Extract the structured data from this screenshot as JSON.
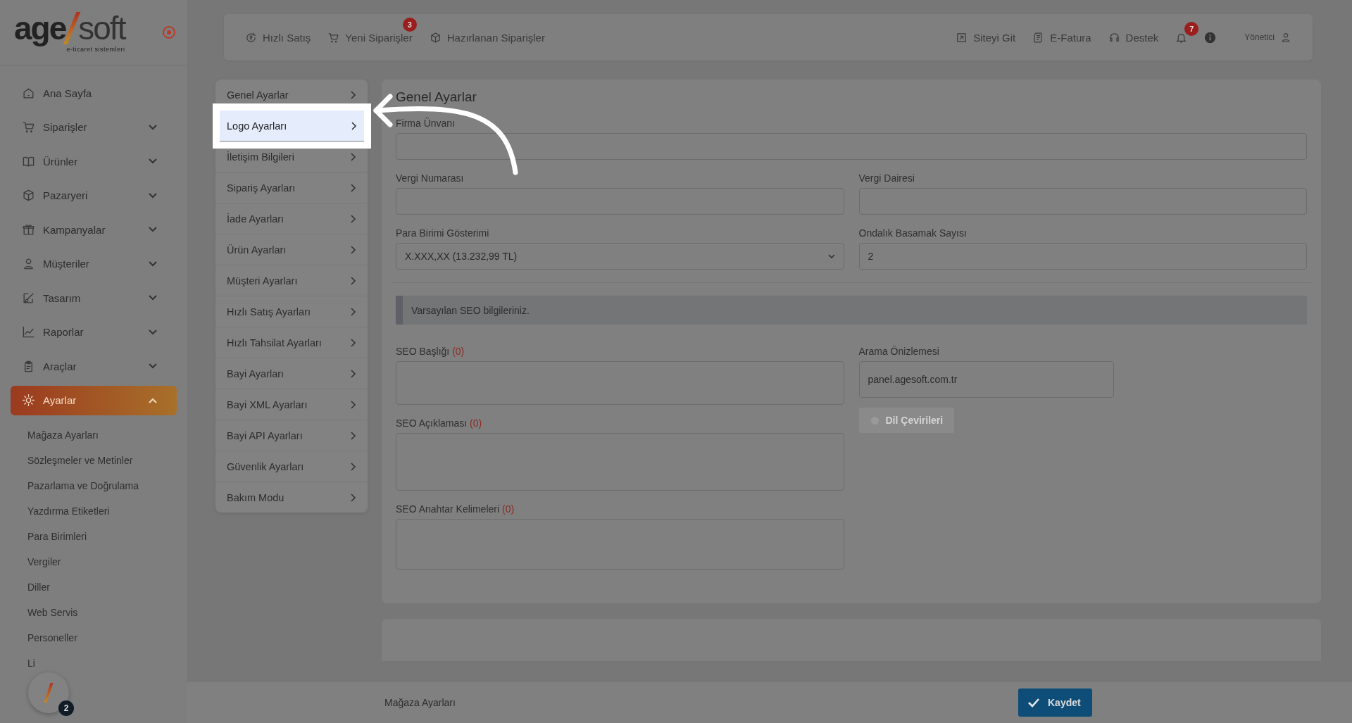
{
  "logo": {
    "left": "age",
    "right": "soft",
    "tagline": "e-ticaret sistemleri"
  },
  "sidebar": {
    "items": [
      {
        "label": "Ana Sayfa",
        "kind": "home",
        "selected": false
      },
      {
        "label": "Siparişler",
        "kind": "cart",
        "expanded": false,
        "selected": false
      },
      {
        "label": "Ürünler",
        "kind": "book",
        "expanded": false,
        "selected": false
      },
      {
        "label": "Pazaryeri",
        "kind": "box",
        "expanded": false,
        "selected": false
      },
      {
        "label": "Kampanyalar",
        "kind": "gift",
        "expanded": false,
        "selected": false
      },
      {
        "label": "Müşteriler",
        "kind": "user",
        "expanded": false,
        "selected": false
      },
      {
        "label": "Tasarım",
        "kind": "brush",
        "expanded": false,
        "selected": false
      },
      {
        "label": "Raporlar",
        "kind": "chart",
        "expanded": false,
        "selected": false
      },
      {
        "label": "Araçlar",
        "kind": "clipboard",
        "expanded": false,
        "selected": false
      },
      {
        "label": "Ayarlar",
        "kind": "gear",
        "expanded": true,
        "selected": true,
        "children": [
          {
            "label": "Mağaza Ayarları"
          },
          {
            "label": "Sözleşmeler ve Metinler"
          },
          {
            "label": "Pazarlama ve Doğrulama"
          },
          {
            "label": "Yazdırma Etiketleri"
          },
          {
            "label": "Para Birimleri"
          },
          {
            "label": "Vergiler"
          },
          {
            "label": "Diller"
          },
          {
            "label": "Web Servis"
          },
          {
            "label": "Personeller"
          },
          {
            "label": "Li"
          }
        ]
      }
    ]
  },
  "topbar": {
    "left": [
      {
        "label": "Hızlı Satış",
        "kind": "coin"
      },
      {
        "label": "Yeni Siparişler",
        "kind": "cart",
        "badge": "3"
      },
      {
        "label": "Hazırlanan Siparişler",
        "kind": "box"
      }
    ],
    "right": [
      {
        "label": "Siteyi Git",
        "kind": "external"
      },
      {
        "label": "E-Fatura",
        "kind": "invoice"
      },
      {
        "label": "Destek",
        "kind": "headset"
      }
    ],
    "notifications_badge": "7",
    "user": "Yönetici"
  },
  "settings_menu": [
    {
      "label": "Genel Ayarlar",
      "highlighted": false
    },
    {
      "label": "Logo Ayarları",
      "highlighted": true
    },
    {
      "label": "İletişim Bilgileri",
      "highlighted": false
    },
    {
      "label": "Sipariş Ayarları",
      "highlighted": false
    },
    {
      "label": "İade Ayarları",
      "highlighted": false
    },
    {
      "label": "Ürün Ayarları",
      "highlighted": false
    },
    {
      "label": "Müşteri Ayarları",
      "highlighted": false
    },
    {
      "label": "Hızlı Satış Ayarları",
      "highlighted": false
    },
    {
      "label": "Hızlı Tahsilat Ayarları",
      "highlighted": false
    },
    {
      "label": "Bayi Ayarları",
      "highlighted": false
    },
    {
      "label": "Bayi XML Ayarları",
      "highlighted": false
    },
    {
      "label": "Bayi API Ayarları",
      "highlighted": false
    },
    {
      "label": "Güvenlik Ayarları",
      "highlighted": false
    },
    {
      "label": "Bakım Modu",
      "highlighted": false
    }
  ],
  "form": {
    "title": "Genel Ayarlar",
    "company": {
      "label": "Firma Ünvanı"
    },
    "tax_number": {
      "label": "Vergi Numarası"
    },
    "tax_office": {
      "label": "Vergi Dairesi"
    },
    "currency_display": {
      "label": "Para Birimi Gösterimi",
      "value": "X.XXX,XX (13.232,99 TL)"
    },
    "decimals": {
      "label": "Ondalık Basamak Sayısı",
      "value": "2"
    },
    "seo_info": "Varsayılan SEO bilgileriniz.",
    "seo_title": {
      "label": "SEO Başlığı",
      "count": "(0)"
    },
    "seo_description": {
      "label": "SEO Açıklaması",
      "count": "(0)"
    },
    "seo_keywords": {
      "label": "SEO Anahtar Kelimeleri",
      "count": "(0)"
    },
    "preview": {
      "label": "Arama Önizlemesi",
      "value": "panel.agesoft.com.tr"
    },
    "translations_button": {
      "label": "Dil Çevirileri",
      "disabled": true
    }
  },
  "footer": {
    "breadcrumb": "Mağaza Ayarları",
    "save": "Kaydet"
  },
  "float_badge": "2"
}
